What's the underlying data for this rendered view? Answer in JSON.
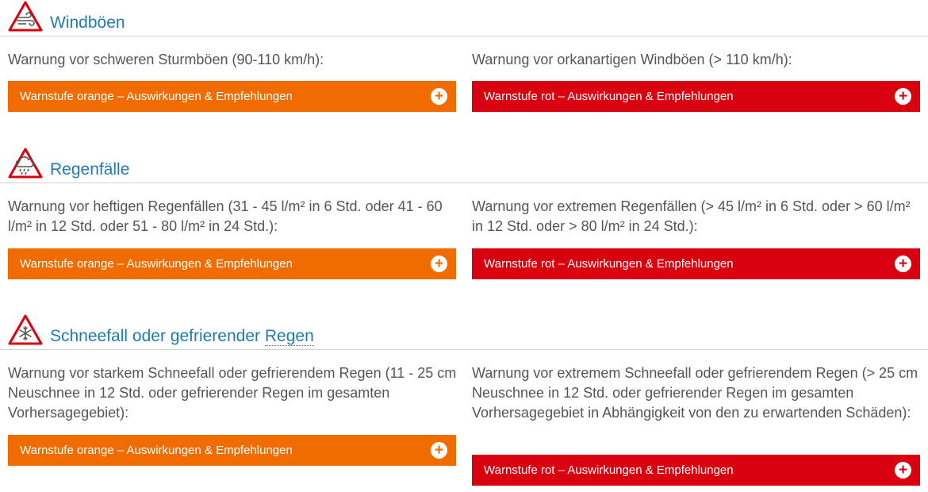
{
  "colors": {
    "orange": "#f06c00",
    "red": "#d9000f",
    "title": "#1f7bb0",
    "text": "#555555"
  },
  "sections": [
    {
      "title": "Windböen",
      "icon": "wind-warning-icon",
      "left_text": "Warnung vor schweren Sturmböen (90-110 km/h):",
      "left_button": "Warnstufe orange – Auswirkungen & Empfehlungen",
      "right_text": "Warnung vor orkanartigen Windböen (> 110 km/h):",
      "right_button": "Warnstufe rot – Auswirkungen & Empfehlungen"
    },
    {
      "title": "Regenfälle",
      "icon": "rain-warning-icon",
      "left_text": "Warnung vor heftigen Regenfällen (31 - 45 l/m² in 6 Std. oder 41 - 60 l/m² in 12 Std. oder 51 - 80 l/m² in 24 Std.):",
      "left_button": "Warnstufe orange – Auswirkungen & Empfehlungen",
      "right_text": "Warnung vor extremen Regenfällen (> 45 l/m² in 6 Std. oder > 60 l/m² in 12 Std. oder > 80 l/m² in 24 Std.):",
      "right_button": "Warnstufe rot – Auswirkungen & Empfehlungen"
    },
    {
      "title_main": "Schneefall oder gefrierender",
      "title_link": "Regen",
      "icon": "snow-warning-icon",
      "left_text": "Warnung vor starkem Schneefall oder gefrierendem Regen (11 - 25 cm Neuschnee in 12 Std. oder gefrierender Regen im gesamten Vorhersagegebiet):",
      "left_button": "Warnstufe orange – Auswirkungen & Empfehlungen",
      "right_text": "Warnung vor extremem Schneefall oder gefrierendem Regen (> 25 cm Neuschnee in 12 Std. oder gefrierender Regen im gesamten Vorhersagegebiet in Abhängigkeit von den zu erwartenden Schäden):",
      "right_button": "Warnstufe rot – Auswirkungen & Empfehlungen"
    }
  ],
  "expand_symbol": "+"
}
